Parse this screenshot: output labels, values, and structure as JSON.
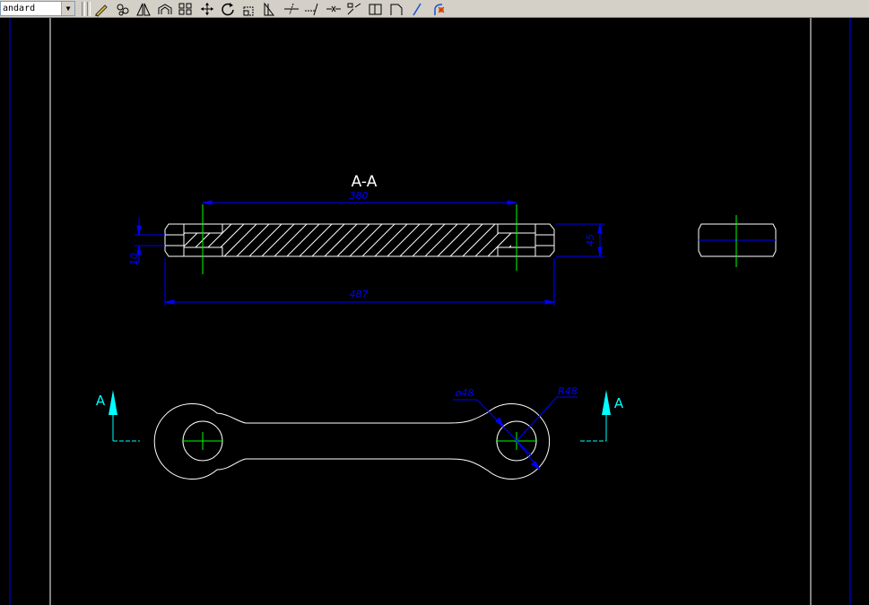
{
  "toolbar": {
    "dimstyle_value": "andard",
    "buttons": [
      {
        "name": "edit-pencil-icon"
      },
      {
        "name": "copy-object-icon"
      },
      {
        "name": "mirror-icon"
      },
      {
        "name": "offset-icon"
      },
      {
        "name": "array-icon"
      },
      {
        "name": "move-icon"
      },
      {
        "name": "rotate-icon"
      },
      {
        "name": "scale-icon"
      },
      {
        "name": "stretch-icon"
      },
      {
        "name": "trim-icon"
      },
      {
        "name": "extend-icon"
      },
      {
        "name": "break-icon"
      },
      {
        "name": "break-at-point-icon"
      },
      {
        "name": "join-icon"
      },
      {
        "name": "chamfer-icon"
      },
      {
        "name": "fillet-icon"
      },
      {
        "name": "explode-icon"
      }
    ]
  },
  "drawing": {
    "section_title": "A-A",
    "dim_inner_length": "380",
    "dim_total_length": "487",
    "dim_thickness": "45",
    "dim_groove": "10",
    "dim_diameter": "ø48",
    "dim_radius": "R48",
    "section_marker_left": "A",
    "section_marker_right": "A"
  },
  "colors": {
    "background": "#000000",
    "outline": "#ffffff",
    "dimension": "#0000ff",
    "centerline": "#00ff00",
    "section_arrow": "#00ffff",
    "border": "#0000ff"
  }
}
